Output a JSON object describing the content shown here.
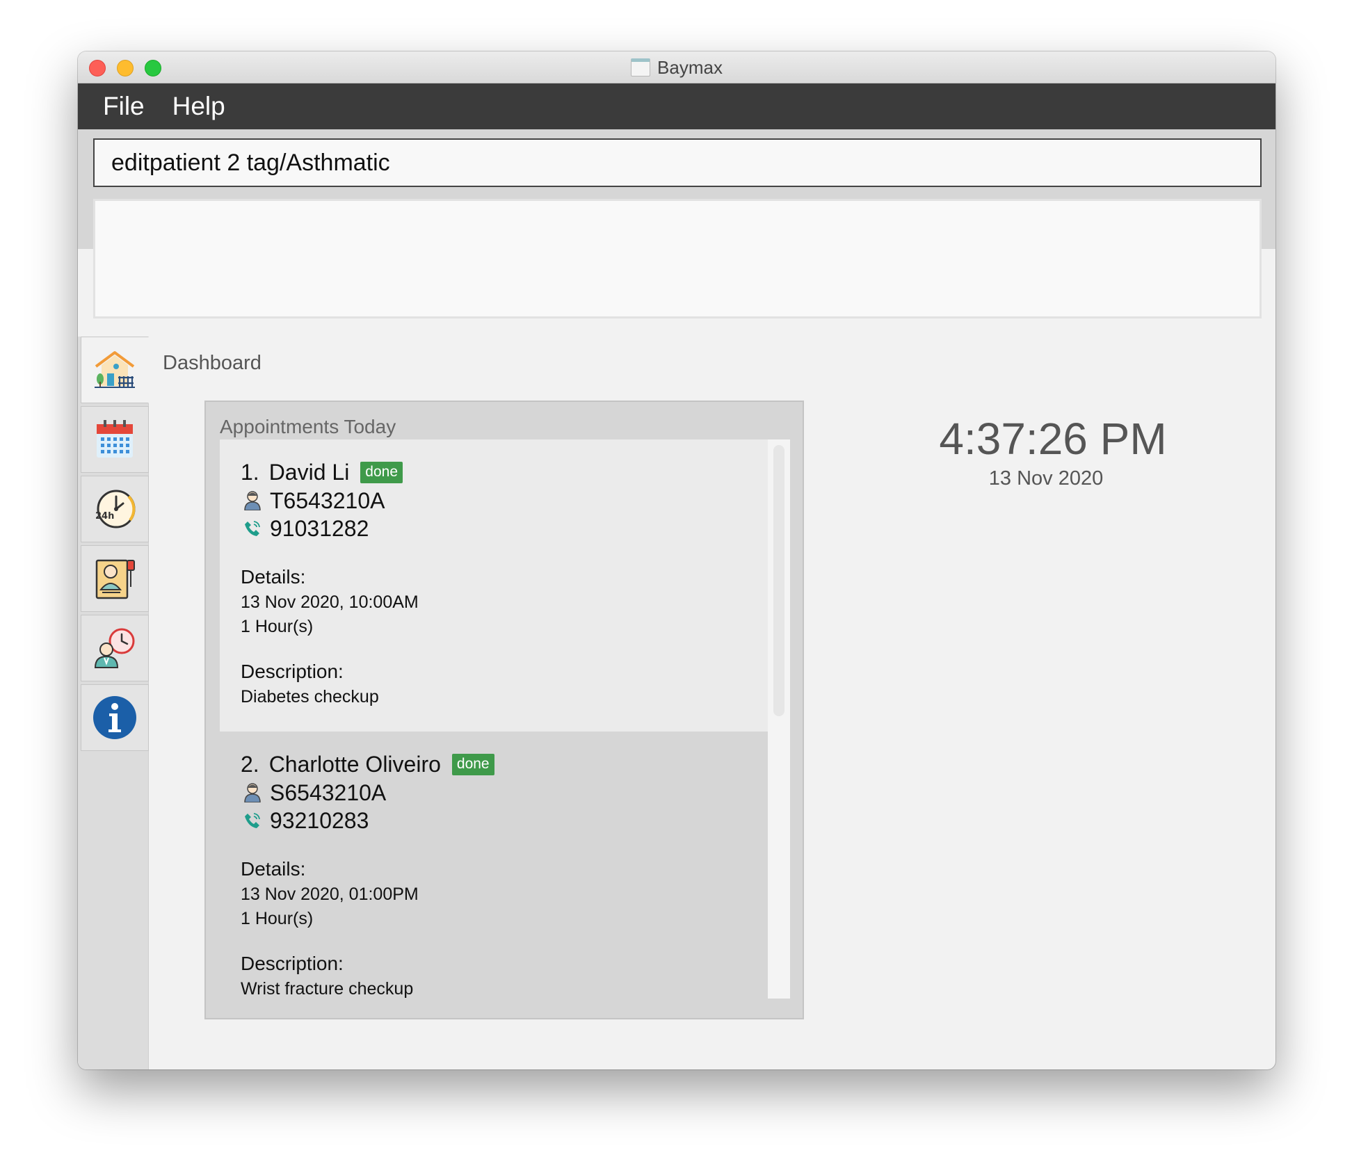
{
  "window": {
    "title": "Baymax"
  },
  "menu": {
    "file": "File",
    "help": "Help"
  },
  "command": {
    "value": "editpatient 2 tag/Asthmatic"
  },
  "result": {
    "text": ""
  },
  "sidebar": {
    "items": [
      {
        "icon": "home-icon"
      },
      {
        "icon": "calendar-icon"
      },
      {
        "icon": "clock-24h-icon"
      },
      {
        "icon": "patient-record-icon"
      },
      {
        "icon": "doctor-schedule-icon"
      },
      {
        "icon": "info-icon"
      }
    ]
  },
  "dashboard": {
    "title": "Dashboard",
    "appointments_title": "Appointments Today",
    "appointments": [
      {
        "index": "1.",
        "name": "David Li",
        "status": "done",
        "nric": "T6543210A",
        "phone": "91031282",
        "details_label": "Details:",
        "datetime": "13 Nov 2020, 10:00AM",
        "duration": "1 Hour(s)",
        "description_label": "Description:",
        "description": "Diabetes checkup"
      },
      {
        "index": "2.",
        "name": "Charlotte Oliveiro",
        "status": "done",
        "nric": "S6543210A",
        "phone": "93210283",
        "details_label": "Details:",
        "datetime": "13 Nov 2020, 01:00PM",
        "duration": "1 Hour(s)",
        "description_label": "Description:",
        "description": "Wrist fracture checkup"
      }
    ],
    "clock": {
      "time": "4:37:26 PM",
      "date": "13 Nov 2020"
    }
  },
  "colors": {
    "menubar": "#3b3b3b",
    "badge": "#3f9a4a",
    "accent": "#1b5fa8"
  }
}
